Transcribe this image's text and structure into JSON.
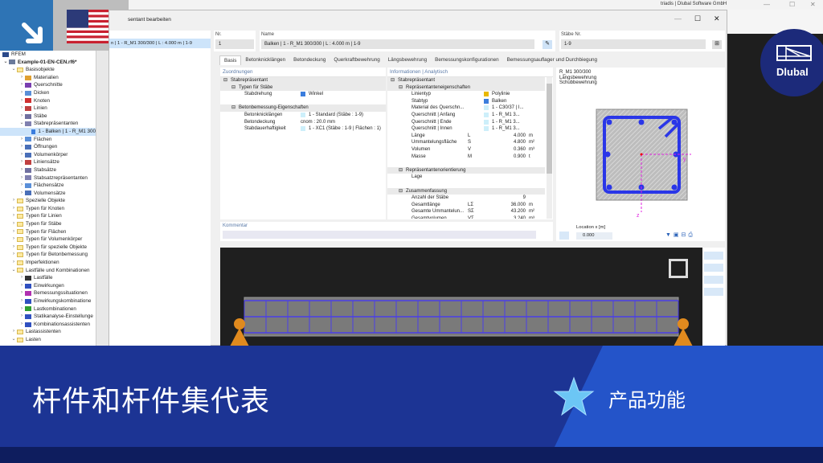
{
  "window": {
    "title_partial": "sentant bearbeiten",
    "app_title_partial": "triadis | Dlubal Software GmbH",
    "min": "—",
    "max": "☐",
    "close": "✕"
  },
  "tree": {
    "root": "RFEM",
    "project": "Example-01-EN-CEN.rf6*",
    "items": [
      {
        "label": "Basisobjekte",
        "level": 1,
        "open": true,
        "folder": true
      },
      {
        "label": "Materialien",
        "level": 2,
        "color": "#e0a030"
      },
      {
        "label": "Querschnitte",
        "level": 2,
        "color": "#7a3fb0"
      },
      {
        "label": "Dicken",
        "level": 2,
        "color": "#5a8fd8"
      },
      {
        "label": "Knoten",
        "level": 2,
        "color": "#d03030"
      },
      {
        "label": "Linien",
        "level": 2,
        "color": "#c04040"
      },
      {
        "label": "Stäbe",
        "level": 2,
        "color": "#7070a0"
      },
      {
        "label": "Stabrepräsentanten",
        "level": 2,
        "open": true,
        "color": "#8080b0"
      },
      {
        "label": "1 - Balken | 1 - R_M1 300",
        "level": 3,
        "selected": true,
        "color": "#3b7ddd"
      },
      {
        "label": "Flächen",
        "level": 2,
        "color": "#5a8fd8"
      },
      {
        "label": "Öffnungen",
        "level": 2,
        "color": "#4a6fb8"
      },
      {
        "label": "Volumenkörper",
        "level": 2,
        "color": "#4a6fb8"
      },
      {
        "label": "Liniensätze",
        "level": 2,
        "color": "#c04040"
      },
      {
        "label": "Stabsätze",
        "level": 2,
        "color": "#7070a0"
      },
      {
        "label": "Stabsatzrepräsentanten",
        "level": 2,
        "color": "#8080b0"
      },
      {
        "label": "Flächensätze",
        "level": 2,
        "color": "#5a8fd8"
      },
      {
        "label": "Volumensätze",
        "level": 2,
        "color": "#4a6fb8"
      },
      {
        "label": "Spezielle Objekte",
        "level": 1,
        "folder": true
      },
      {
        "label": "Typen für Knoten",
        "level": 1,
        "folder": true
      },
      {
        "label": "Typen für Linien",
        "level": 1,
        "folder": true
      },
      {
        "label": "Typen für Stäbe",
        "level": 1,
        "folder": true
      },
      {
        "label": "Typen für Flächen",
        "level": 1,
        "folder": true
      },
      {
        "label": "Typen für Volumenkörper",
        "level": 1,
        "folder": true
      },
      {
        "label": "Typen für spezielle Objekte",
        "level": 1,
        "folder": true
      },
      {
        "label": "Typen für Betonbemessung",
        "level": 1,
        "folder": true
      },
      {
        "label": "Imperfektionen",
        "level": 1,
        "folder": true
      },
      {
        "label": "Lastfälle und Kombinationen",
        "level": 1,
        "open": true,
        "folder": true
      },
      {
        "label": "Lastfälle",
        "level": 2,
        "color": "#333"
      },
      {
        "label": "Einwirkungen",
        "level": 2,
        "color": "#3050c0"
      },
      {
        "label": "Bemessungssituationen",
        "level": 2,
        "color": "#b030b0"
      },
      {
        "label": "Einwirkungskombinatione",
        "level": 2,
        "color": "#3050c0"
      },
      {
        "label": "Lastkombinationen",
        "level": 2,
        "color": "#30a030"
      },
      {
        "label": "Statikanalyse-Einstellunge",
        "level": 2,
        "color": "#3050c0"
      },
      {
        "label": "Kombinationsassistenten",
        "level": 2,
        "color": "#3050c0"
      },
      {
        "label": "Lastassistenten",
        "level": 1,
        "folder": true
      },
      {
        "label": "Lasten",
        "level": 1,
        "open": true,
        "folder": true
      }
    ]
  },
  "dialog": {
    "list_item": "n | 1 - R_M1 300/300 | L : 4.000 m | 1-9",
    "nr_label": "Nr.",
    "nr_value": "1",
    "name_label": "Name",
    "name_value": "Balken | 1 - R_M1 300/300 | L : 4.000 m | 1-9",
    "staebe_label": "Stäbe Nr.",
    "staebe_value": "1-9",
    "tabs": [
      "Basis",
      "Betonknicklängen",
      "Betondeckung",
      "Querkraftbewehrung",
      "Längsbewehrung",
      "Bemessungskonfigurationen",
      "Bemessungsauflager und Durchbiegung"
    ],
    "zuordnungen": {
      "title": "Zuordnungen",
      "rows": [
        {
          "t": "g",
          "label": "Stabrepräsentant",
          "ind": 0
        },
        {
          "t": "g",
          "label": "Typen für Stäbe",
          "ind": 1
        },
        {
          "t": "r",
          "label": "Stabdrehung",
          "value": "Winkel",
          "color": "#3b7ddd"
        },
        {
          "t": "b"
        },
        {
          "t": "g",
          "label": "Betonbemessung-Eigenschaften",
          "ind": 1
        },
        {
          "t": "r",
          "label": "Betonknicklängen",
          "value": "1 - Standard (Stäbe : 1-9)",
          "color": "#cdeffa"
        },
        {
          "t": "r",
          "label": "Betondeckung",
          "value": "cnom : 20.0 mm"
        },
        {
          "t": "r",
          "label": "Stabdauerhaftigkeit",
          "value": "1 - XC1 (Stäbe : 1-9 | Flächen : 1)",
          "color": "#cdeffa"
        }
      ]
    },
    "info": {
      "title": "Informationen | Analytisch",
      "rows": [
        {
          "t": "g",
          "label": "Stabrepräsentant",
          "ind": 0
        },
        {
          "t": "g",
          "label": "Repräsentanteneigenschaften",
          "ind": 1
        },
        {
          "t": "r",
          "label": "Linientyp",
          "value": "Polylinie",
          "color": "#e8b800"
        },
        {
          "t": "r",
          "label": "Stabtyp",
          "value": "Balken",
          "color": "#3b7ddd"
        },
        {
          "t": "r",
          "label": "Material des Querschn...",
          "value": "1 - C30/37 | I...",
          "color": "#cdeffa"
        },
        {
          "t": "r",
          "label": "Querschnitt | Anfang",
          "value": "1 - R_M1 3...",
          "color": "#cdeffa"
        },
        {
          "t": "r",
          "label": "Querschnitt | Ende",
          "value": "1 - R_M1 3...",
          "color": "#cdeffa"
        },
        {
          "t": "r",
          "label": "Querschnitt | Innen",
          "value": "1 - R_M1 3...",
          "color": "#cdeffa"
        },
        {
          "t": "n",
          "label": "Länge",
          "sym": "L",
          "num": "4.000",
          "unit": "m"
        },
        {
          "t": "n",
          "label": "Ummantelungsfläche",
          "sym": "S",
          "num": "4.800",
          "unit": "m²"
        },
        {
          "t": "n",
          "label": "Volumen",
          "sym": "V",
          "num": "0.360",
          "unit": "m³"
        },
        {
          "t": "n",
          "label": "Masse",
          "sym": "M",
          "num": "0.900",
          "unit": "t"
        },
        {
          "t": "b"
        },
        {
          "t": "g",
          "label": "Repräsentantenorientierung",
          "ind": 1
        },
        {
          "t": "r",
          "label": "Lage",
          "value": ""
        },
        {
          "t": "b"
        },
        {
          "t": "g",
          "label": "Zusammenfassung",
          "ind": 1
        },
        {
          "t": "n",
          "label": "Anzahl der Stäbe",
          "sym": "",
          "num": "9",
          "unit": ""
        },
        {
          "t": "n",
          "label": "Gesamtlänge",
          "sym": "LΣ",
          "num": "36.000",
          "unit": "m"
        },
        {
          "t": "n",
          "label": "Gesamte Ummantelun...",
          "sym": "SΣ",
          "num": "43.200",
          "unit": "m²"
        },
        {
          "t": "n",
          "label": "Gesamtvolumen",
          "sym": "VΣ",
          "num": "3.240",
          "unit": "m³"
        }
      ]
    },
    "preview": {
      "lines": [
        "R_M1 300/300",
        "Längsbewehrung",
        "Schubbewehrung"
      ],
      "axis_y": "y",
      "axis_z": "z",
      "location_label": "Location x [m]",
      "location_value": "0.000"
    },
    "comment_label": "Kommentar",
    "members_in_view": 20
  },
  "banner": {
    "title": "杆件和杆件集代表",
    "feature": "产品功能",
    "logo_text": "Dlubal",
    "accent": "#1c3494"
  }
}
